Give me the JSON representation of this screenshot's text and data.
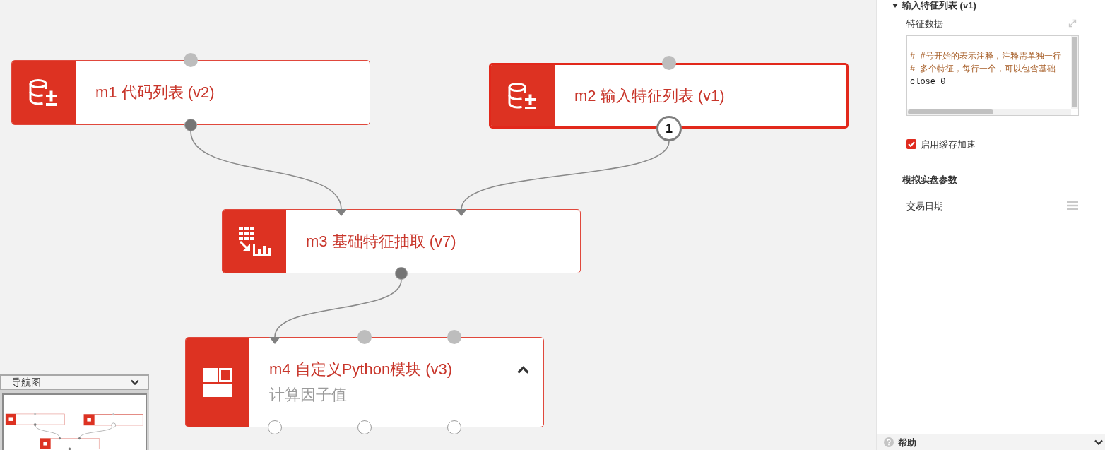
{
  "canvas": {
    "nodes": [
      {
        "title": "m1 代码列表 (v2)",
        "selected": false,
        "inputs": [
          {
            "kind": "open"
          }
        ],
        "outputs": [
          {
            "kind": "linked"
          }
        ]
      },
      {
        "title": "m2 输入特征列表 (v1)",
        "selected": true,
        "inputs": [
          {
            "kind": "open"
          }
        ],
        "outputs": [
          {
            "kind": "count",
            "label": "1"
          }
        ]
      },
      {
        "title": "m3 基础特征抽取 (v7)",
        "selected": false,
        "inputs": [
          {
            "kind": "linked"
          },
          {
            "kind": "linked"
          }
        ],
        "outputs": [
          {
            "kind": "linked"
          }
        ]
      },
      {
        "title": "m4 自定义Python模块 (v3)",
        "subtitle": "计算因子值",
        "selected": false,
        "inputs": [
          {
            "kind": "linked"
          },
          {
            "kind": "open"
          },
          {
            "kind": "open"
          }
        ],
        "outputs": [
          {
            "kind": "open"
          },
          {
            "kind": "open"
          },
          {
            "kind": "open"
          }
        ]
      }
    ]
  },
  "navigator": {
    "title": "导航图"
  },
  "properties": {
    "module_title": "输入特征列表 (v1)",
    "field_label": "特征数据",
    "code_lines": [
      {
        "kind": "comment",
        "text": "# #号开始的表示注释，注释需单独一行"
      },
      {
        "kind": "comment",
        "text": "# 多个特征，每行一个，可以包含基础"
      },
      {
        "kind": "code",
        "text": "close_0"
      }
    ],
    "cache": {
      "label": "启用缓存加速",
      "checked": true
    },
    "section_title": "模拟实盘参数",
    "param_label": "交易日期"
  },
  "help_bar": {
    "label": "帮助"
  }
}
